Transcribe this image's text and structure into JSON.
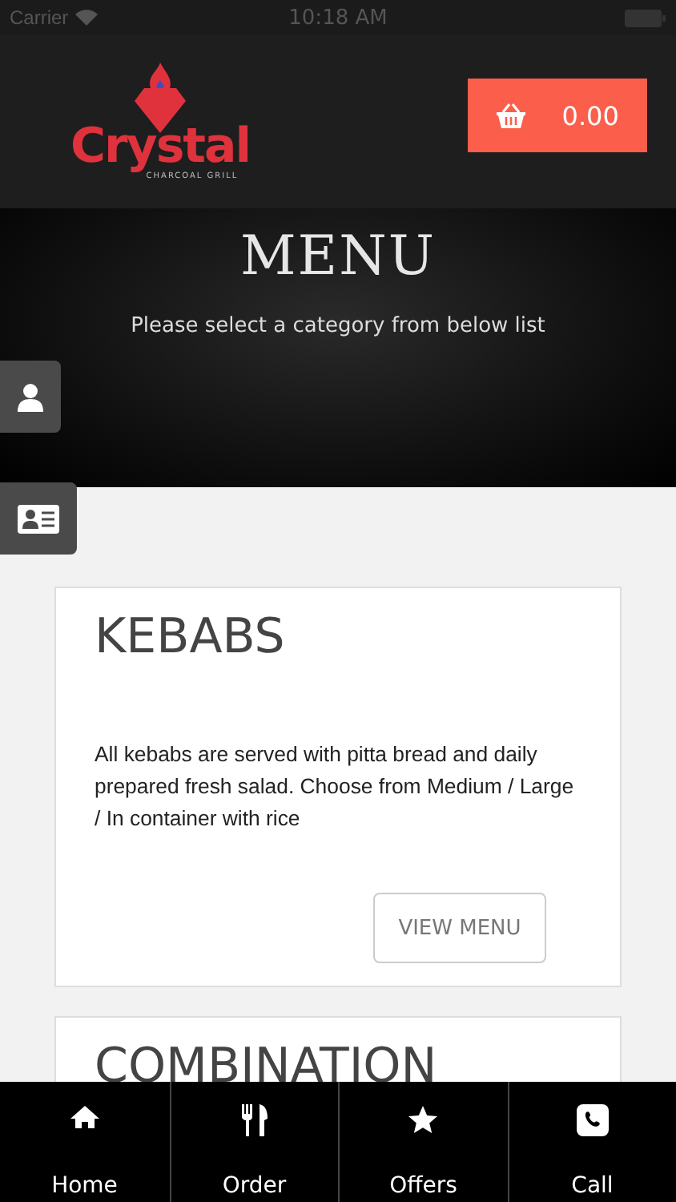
{
  "status_bar": {
    "carrier": "Carrier",
    "time": "10:18 AM"
  },
  "header": {
    "logo": {
      "name": "Crystal",
      "tagline": "CHARCOAL GRILL"
    },
    "cart_total": "0.00"
  },
  "hero": {
    "title": "MENU",
    "subtitle": "Please select a category from below list"
  },
  "categories": [
    {
      "title": "KEBABS",
      "description": "All kebabs are served with pitta bread and daily prepared fresh salad. Choose from Medium / Large / In container with rice",
      "button": "VIEW MENU"
    },
    {
      "title": "COMBINATION"
    }
  ],
  "tabs": [
    {
      "kind": "home",
      "label": "Home"
    },
    {
      "kind": "order",
      "label": "Order"
    },
    {
      "kind": "offers",
      "label": "Offers"
    },
    {
      "kind": "call",
      "label": "Call"
    }
  ]
}
